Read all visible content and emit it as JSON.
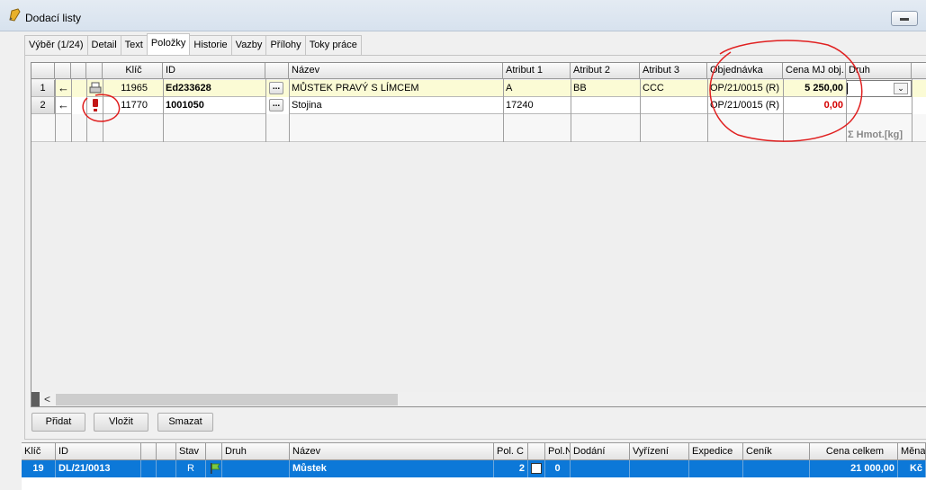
{
  "window": {
    "title": "Dodací  listy"
  },
  "tabs": [
    {
      "label": "Výběr (1/24)"
    },
    {
      "label": "Detail"
    },
    {
      "label": "Text"
    },
    {
      "label": "Položky"
    },
    {
      "label": "Historie"
    },
    {
      "label": "Vazby"
    },
    {
      "label": "Přílohy"
    },
    {
      "label": "Toky práce"
    }
  ],
  "items_grid": {
    "headers": {
      "key": "Klíč",
      "id": "ID",
      "name": "Název",
      "attr1": "Atribut 1",
      "attr2": "Atribut 2",
      "attr3": "Atribut 3",
      "order": "Objednávka",
      "unit_price": "Cena MJ obj.",
      "type": "Druh"
    },
    "rows": [
      {
        "num": "1",
        "arrow": "←",
        "key": "11965",
        "id": "Ed233628",
        "dots": "...",
        "name": "MŮSTEK PRAVÝ S LÍMCEM",
        "attr1": "A",
        "attr2": "BB",
        "attr3": "CCC",
        "order": "OP/21/0015 (R)",
        "unit_price": "5 250,00",
        "type": ""
      },
      {
        "num": "2",
        "arrow": "←",
        "key": "11770",
        "id": "1001050",
        "dots": "...",
        "name": "Stojina",
        "attr1": "17240",
        "attr2": "",
        "attr3": "",
        "order": "OP/21/0015 (R)",
        "unit_price": "0,00",
        "type": ""
      }
    ],
    "sum_label": "Σ Hmot.[kg]",
    "scroll_left": "<",
    "colors": {
      "price_zero": "#d40000",
      "row_highlight": "#fbfbd5"
    }
  },
  "buttons": {
    "add": "Přidat",
    "insert": "Vložit",
    "delete": "Smazat"
  },
  "summary_grid": {
    "headers": {
      "key": "Klíč",
      "id": "ID",
      "state": "Stav",
      "type": "Druh",
      "name": "Název",
      "pol_c": "Pol. C",
      "pol_n": "Pol.N",
      "delivery": "Dodání",
      "settlement": "Vyřízení",
      "expedition": "Expedice",
      "pricelist": "Ceník",
      "total": "Cena celkem",
      "currency": "Měna"
    },
    "row": {
      "key": "19",
      "id": "DL/21/0013",
      "state": "R",
      "type": "",
      "name": "Můstek",
      "pol_c": "2",
      "pol_n": "0",
      "delivery": "",
      "settlement": "",
      "expedition": "",
      "pricelist": "",
      "total": "21 000,00",
      "currency": "Kč"
    },
    "colors": {
      "selected_row": "#0c78d8"
    }
  },
  "annotation": {
    "color": "#e02020"
  }
}
